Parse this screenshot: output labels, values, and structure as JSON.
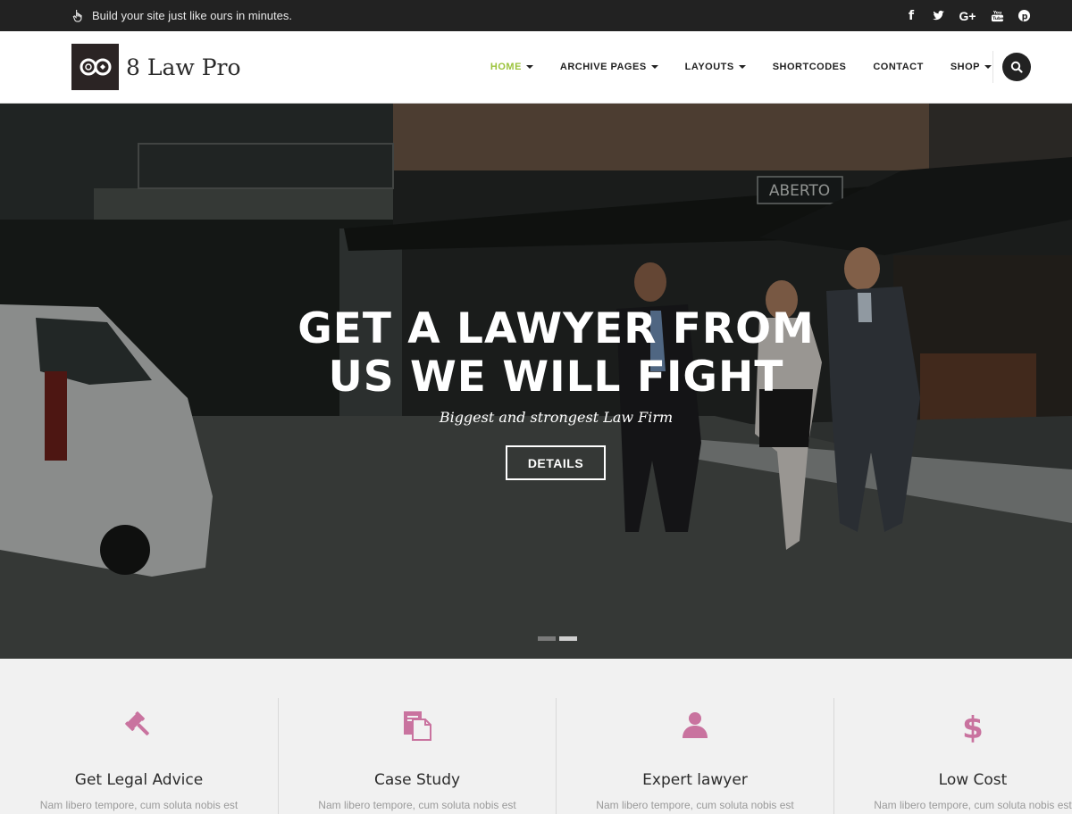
{
  "topbar": {
    "promo_text": "Build your site just like ours in minutes.",
    "promo_icon": "hand-pointer-icon",
    "social": [
      "facebook-icon",
      "twitter-icon",
      "google-plus-icon",
      "youtube-icon",
      "pinterest-icon"
    ]
  },
  "header": {
    "logo_text": "8 Law Pro",
    "nav": [
      {
        "label": "HOME",
        "dropdown": true,
        "active": true
      },
      {
        "label": "ARCHIVE PAGES",
        "dropdown": true
      },
      {
        "label": "LAYOUTS",
        "dropdown": true
      },
      {
        "label": "SHORTCODES",
        "dropdown": false
      },
      {
        "label": "CONTACT",
        "dropdown": false
      },
      {
        "label": "SHOP",
        "dropdown": true
      }
    ],
    "search_icon": "search-icon"
  },
  "hero": {
    "title_line1": "GET A LAWYER FROM",
    "title_line2": "US WE WILL FIGHT",
    "subtitle": "Biggest and strongest Law Firm",
    "button_label": "DETAILS",
    "sign_text": "ABERTO",
    "slides": 2,
    "active_slide": 2
  },
  "features": [
    {
      "title": "Get Legal Advice",
      "icon": "gavel-icon",
      "text": "Nam libero tempore, cum soluta nobis est"
    },
    {
      "title": "Case Study",
      "icon": "document-icon",
      "text": "Nam libero tempore, cum soluta nobis est"
    },
    {
      "title": "Expert lawyer",
      "icon": "user-icon",
      "text": "Nam libero tempore, cum soluta nobis est"
    },
    {
      "title": "Low Cost",
      "icon": "dollar-icon",
      "text": "Nam libero tempore, cum soluta nobis est"
    }
  ],
  "colors": {
    "accent": "#9bc33c",
    "icon_color": "#c9739f",
    "topbar_bg": "#222222"
  }
}
